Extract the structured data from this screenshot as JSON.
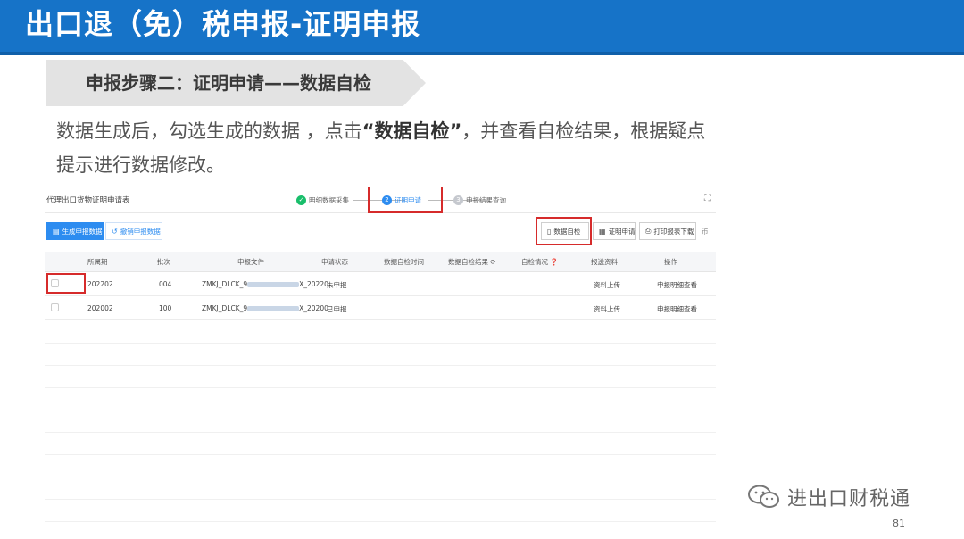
{
  "slide": {
    "title": "出口退（免）税申报-证明申报",
    "step_banner": "申报步骤二：证明申请——数据自检",
    "desc_part1": "数据生成后，勾选生成的数据 ，点击",
    "desc_bold": "“数据自检”",
    "desc_part2": "，并查看自检结果，根据疑点提示进行数据修改。",
    "watermark": "进出口财税通",
    "page_number": "81"
  },
  "app": {
    "title": "代理出口货物证明申请表",
    "steps": [
      {
        "num": "✓",
        "label": "明细数据采集",
        "state": "done"
      },
      {
        "num": "2",
        "label": "证明申请",
        "state": "active"
      },
      {
        "num": "3",
        "label": "申报结果查询",
        "state": "todo"
      }
    ],
    "toolbar": {
      "generate": "生成申报数据",
      "revoke": "撤销申报数据",
      "selfcheck": "数据自检",
      "apply": "证明申请",
      "print": "打印报表下载",
      "more": "币"
    },
    "columns": [
      "所属期",
      "批次",
      "申报文件",
      "申请状态",
      "数据自检时间",
      "数据自检结果",
      "自检情况",
      "报送资料",
      "操作"
    ],
    "rows": [
      {
        "period": "202202",
        "batch": "004",
        "file_prefix": "ZMKJ_DLCK_9",
        "file_suffix": "X_20220",
        "status": "未申报",
        "material": "资料上传",
        "action": "申报明细查看"
      },
      {
        "period": "202002",
        "batch": "100",
        "file_prefix": "ZMKJ_DLCK_9",
        "file_suffix": "X_20200",
        "status": "已申报",
        "material": "资料上传",
        "action": "申报明细查看"
      }
    ]
  },
  "colors": {
    "title_bar": "#1673c8",
    "primary": "#2d8cf0",
    "highlight": "#d62b2b",
    "step_done": "#19be6b"
  }
}
